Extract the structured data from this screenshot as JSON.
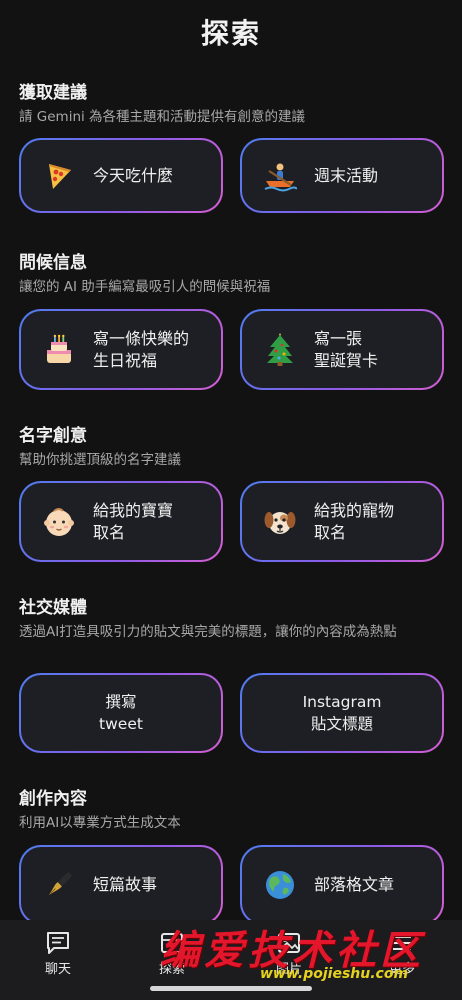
{
  "header": {
    "title": "探索"
  },
  "sections": [
    {
      "title": "獲取建議",
      "subtitle": "請 Gemini 為各種主題和活動提供有創意的建議",
      "cards": [
        {
          "icon": "pizza-icon",
          "label": "今天吃什麼"
        },
        {
          "icon": "rowing-boat-icon",
          "label": "週末活動"
        }
      ]
    },
    {
      "title": "問候信息",
      "subtitle": "讓您的 AI 助手編寫最吸引人的問候與祝福",
      "cards": [
        {
          "icon": "birthday-cake-icon",
          "label": "寫一條快樂的\n生日祝福"
        },
        {
          "icon": "christmas-tree-icon",
          "label": "寫一張\n聖誕賀卡"
        }
      ]
    },
    {
      "title": "名字創意",
      "subtitle": "幫助你挑選頂級的名字建議",
      "cards": [
        {
          "icon": "baby-face-icon",
          "label": "給我的寶寶\n取名"
        },
        {
          "icon": "dog-face-icon",
          "label": "給我的寵物\n取名"
        }
      ]
    },
    {
      "title": "社交媒體",
      "subtitle": "透過AI打造具吸引力的貼文與完美的標題，讓你的內容成為熱點",
      "cards": [
        {
          "icon": "",
          "label": "撰寫\ntweet"
        },
        {
          "icon": "",
          "label": "Instagram\n貼文標題"
        }
      ]
    },
    {
      "title": "創作內容",
      "subtitle": "利用AI以專業方式生成文本",
      "cards": [
        {
          "icon": "fountain-pen-icon",
          "label": "短篇故事"
        },
        {
          "icon": "globe-icon",
          "label": "部落格文章"
        }
      ]
    }
  ],
  "bottom_nav": {
    "items": [
      {
        "icon": "chat-icon",
        "label": "聊天"
      },
      {
        "icon": "explore-icon",
        "label": "探索"
      },
      {
        "icon": "image-icon",
        "label": "图片"
      },
      {
        "icon": "more-icon",
        "label": "更多"
      }
    ]
  },
  "watermark": {
    "text": "编爱技术社区",
    "url": "www.pojieshu.com"
  }
}
